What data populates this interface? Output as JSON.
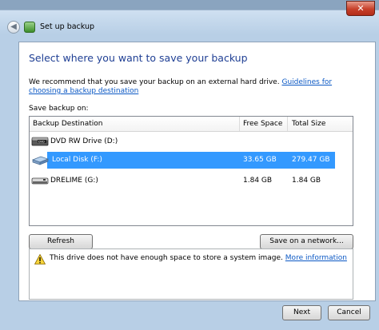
{
  "window": {
    "title": "Set up backup",
    "close_glyph": "✕"
  },
  "page": {
    "heading": "Select where you want to save your backup",
    "recommend_text": "We recommend that you save your backup on an external hard drive.",
    "recommend_link": "Guidelines for choosing a backup destination",
    "save_on_label": "Save backup on:"
  },
  "table": {
    "columns": [
      "Backup Destination",
      "Free Space",
      "Total Size"
    ],
    "rows": [
      {
        "name": "DVD RW Drive (D:)",
        "free": "",
        "total": "",
        "icon": "dvd-drive-icon",
        "selected": false
      },
      {
        "name": "Local Disk (F:)",
        "free": "33.65 GB",
        "total": "279.47 GB",
        "icon": "hard-drive-icon",
        "selected": true
      },
      {
        "name": "DRELIME (G:)",
        "free": "1.84 GB",
        "total": "1.84 GB",
        "icon": "removable-drive-icon",
        "selected": false
      }
    ]
  },
  "buttons": {
    "refresh": "Refresh",
    "save_network": "Save on a network...",
    "next": "Next",
    "cancel": "Cancel"
  },
  "warning": {
    "text": "This drive does not have enough space to store a system image.",
    "link": "More information",
    "icon": "warning-icon"
  },
  "colors": {
    "heading": "#1f3f94",
    "selection": "#3399ff",
    "link": "#0b58c4"
  }
}
